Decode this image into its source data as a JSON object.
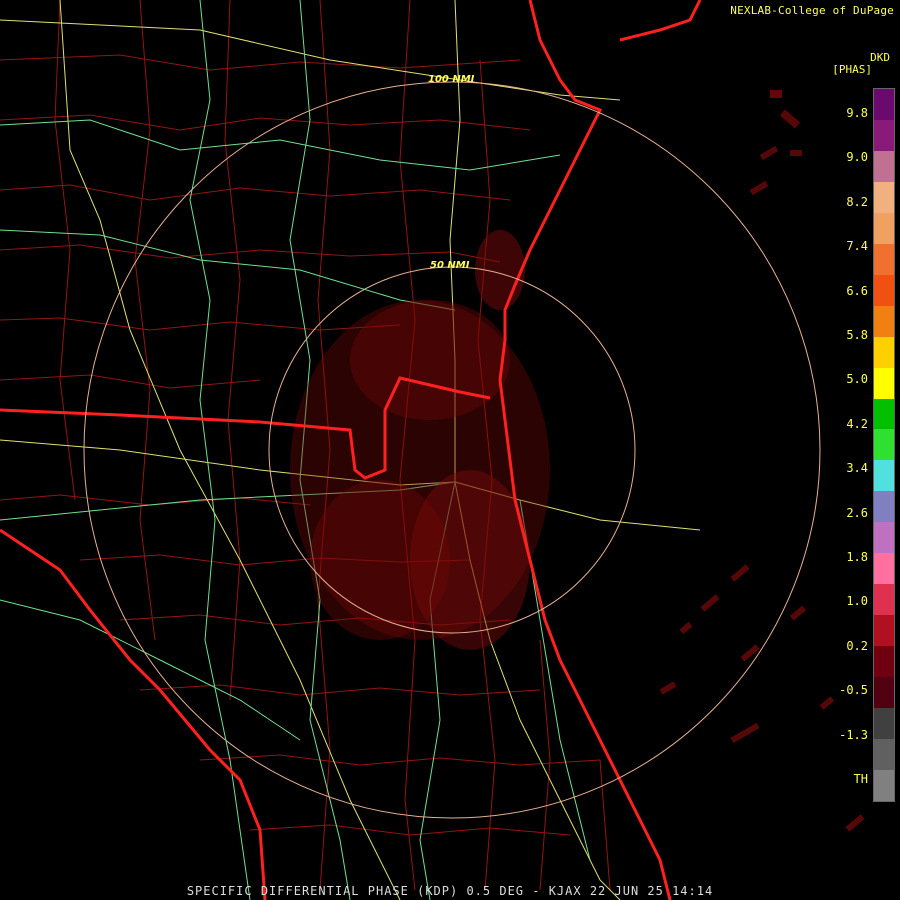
{
  "credit": "NEXLAB-College of DuPage",
  "legend": {
    "product": "DKD",
    "unit": "[PHAS]",
    "labels": [
      "9.8",
      "9.0",
      "8.2",
      "7.4",
      "6.6",
      "5.8",
      "5.0",
      "4.2",
      "3.4",
      "2.6",
      "1.8",
      "1.0",
      "0.2",
      "-0.5",
      "-1.3",
      "TH"
    ],
    "colors": [
      "#6a0a6e",
      "#8a1a7a",
      "#c07090",
      "#f0b080",
      "#f0a060",
      "#f07030",
      "#f05010",
      "#f08010",
      "#ffd000",
      "#ffff00",
      "#00c000",
      "#30e030",
      "#50e0e0",
      "#8080c0",
      "#c070c0",
      "#ff70a0",
      "#e03050",
      "#b01020",
      "#700010",
      "#500010",
      "#404040",
      "#606060",
      "#808080"
    ]
  },
  "rings": {
    "inner": "50 NMI",
    "outer": "100 NMI"
  },
  "footer": "SPECIFIC DIFFERENTIAL PHASE (KDP) 0.5 DEG - KJAX 22 JUN 25 14:14",
  "colors": {
    "coast": "#ff2020",
    "counties": "#b01818",
    "highways_yellow": "#e0e070",
    "highways_green": "#70e090",
    "ring": "#e8b090",
    "echo": "#7a0a0a"
  }
}
